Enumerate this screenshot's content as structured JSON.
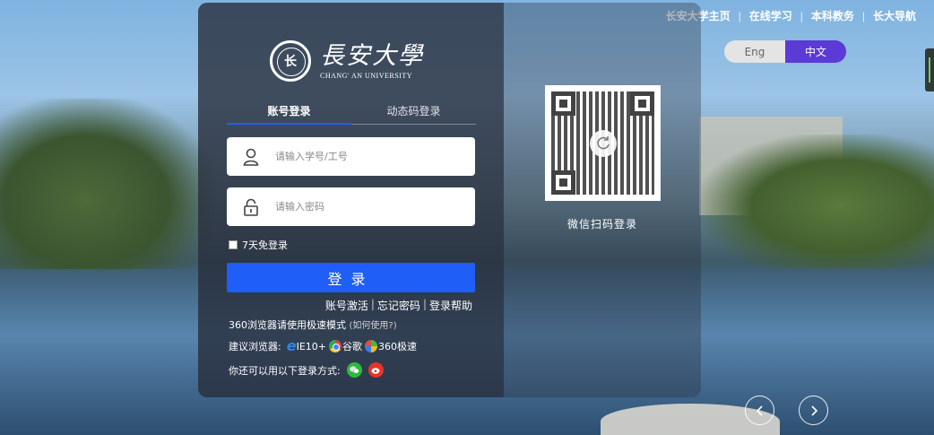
{
  "top_nav": {
    "items": [
      "长安大学主页",
      "在线学习",
      "本科教务",
      "长大导航"
    ],
    "separator": "|"
  },
  "language": {
    "english": "Eng",
    "chinese": "中文",
    "selected": "中文"
  },
  "logo": {
    "seal_text": "长",
    "name_cn": "長安大學",
    "name_en": "CHANG' AN UNIVERSITY"
  },
  "tabs": [
    {
      "label": "账号登录",
      "active": true
    },
    {
      "label": "动态码登录",
      "active": false
    }
  ],
  "form": {
    "username_placeholder": "请输入学号/工号",
    "password_placeholder": "请输入密码",
    "remember_label": "7天免登录",
    "login_button": "登录"
  },
  "links": [
    "账号激活",
    "忘记密码",
    "登录帮助"
  ],
  "hint": {
    "text": "360浏览器请使用极速模式",
    "how": "(如何使用?)"
  },
  "browsers": {
    "prefix": "建议浏览器:",
    "ie": "IE10+",
    "chrome": "谷歌",
    "speed360": "360极速"
  },
  "other_login": {
    "label": "你还可以用以下登录方式:"
  },
  "qr": {
    "label": "微信扫码登录"
  },
  "colors": {
    "accent": "#1f5ef7",
    "lang_active": "#5b3ad6",
    "wechat": "#2dbb3b",
    "weibo": "#e5342b"
  },
  "icons": [
    "user-icon",
    "lock-icon",
    "refresh-icon",
    "ie-icon",
    "chrome-icon",
    "360-icon",
    "wechat-icon",
    "weibo-icon",
    "chevron-left-icon",
    "chevron-right-icon"
  ]
}
